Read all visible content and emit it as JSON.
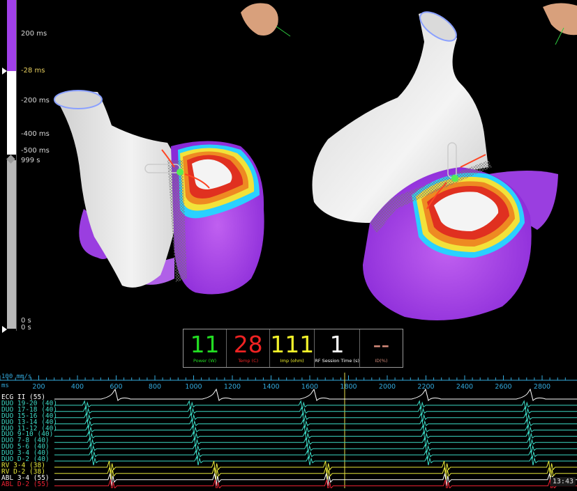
{
  "scale": {
    "top_labels": [
      "200 ms",
      "-200 ms",
      "-400 ms",
      "-500 ms"
    ],
    "marker_upper": "-28 ms",
    "marker_lower": "999 s",
    "bottom_labels": [
      "0 s",
      "0 s"
    ],
    "colors": {
      "lat_top": "#a040e8",
      "white": "#ffffff",
      "gray": "#b8b8b8"
    }
  },
  "rf_panel": [
    {
      "value": "11",
      "label": "Power (W)",
      "color": "#22dd22"
    },
    {
      "value": "28",
      "label": "Temp (C)",
      "color": "#ee2222"
    },
    {
      "value": "111",
      "label": "Imp (ohm)",
      "color": "#f2f22a"
    },
    {
      "value": "1",
      "label": "RF Session Time (s)",
      "color": "#ffffff"
    },
    {
      "value": "--",
      "label": "ID(%)",
      "color": "#d08878"
    }
  ],
  "timeline": {
    "speed": "100 mm/s",
    "unit_label": "ms",
    "ticks": [
      "200",
      "400",
      "600",
      "800",
      "1000",
      "1200",
      "1400",
      "1600",
      "1800",
      "2000",
      "2200",
      "2400",
      "2600",
      "2800"
    ],
    "color": "#33aadd"
  },
  "channels": [
    {
      "label": "ECG II (55)",
      "color": "#ffffff"
    },
    {
      "label": "DUO 19-20 (40)",
      "color": "#3cd8c4"
    },
    {
      "label": "DUO 17-18 (40)",
      "color": "#3cd8c4"
    },
    {
      "label": "DUO 15-16 (40)",
      "color": "#3cd8c4"
    },
    {
      "label": "DUO 13-14 (40)",
      "color": "#3cd8c4"
    },
    {
      "label": "DUO 11-12 (40)",
      "color": "#3cd8c4"
    },
    {
      "label": "DUO 9-10 (40)",
      "color": "#3cd8c4"
    },
    {
      "label": "DUO 7-8 (40)",
      "color": "#3cd8c4"
    },
    {
      "label": "DUO 5-6 (40)",
      "color": "#3cd8c4"
    },
    {
      "label": "DUO 3-4 (40)",
      "color": "#3cd8c4"
    },
    {
      "label": "DUO D-2 (40)",
      "color": "#3cd8c4"
    },
    {
      "label": "RV 3-4 (38)",
      "color": "#e8e83a"
    },
    {
      "label": "RV D-2 (38)",
      "color": "#e8e83a"
    },
    {
      "label": "ABL 3-4 (55)",
      "color": "#ffffff"
    },
    {
      "label": "ABL D-2 (55)",
      "color": "#ee2233"
    }
  ],
  "clock": "13:43"
}
